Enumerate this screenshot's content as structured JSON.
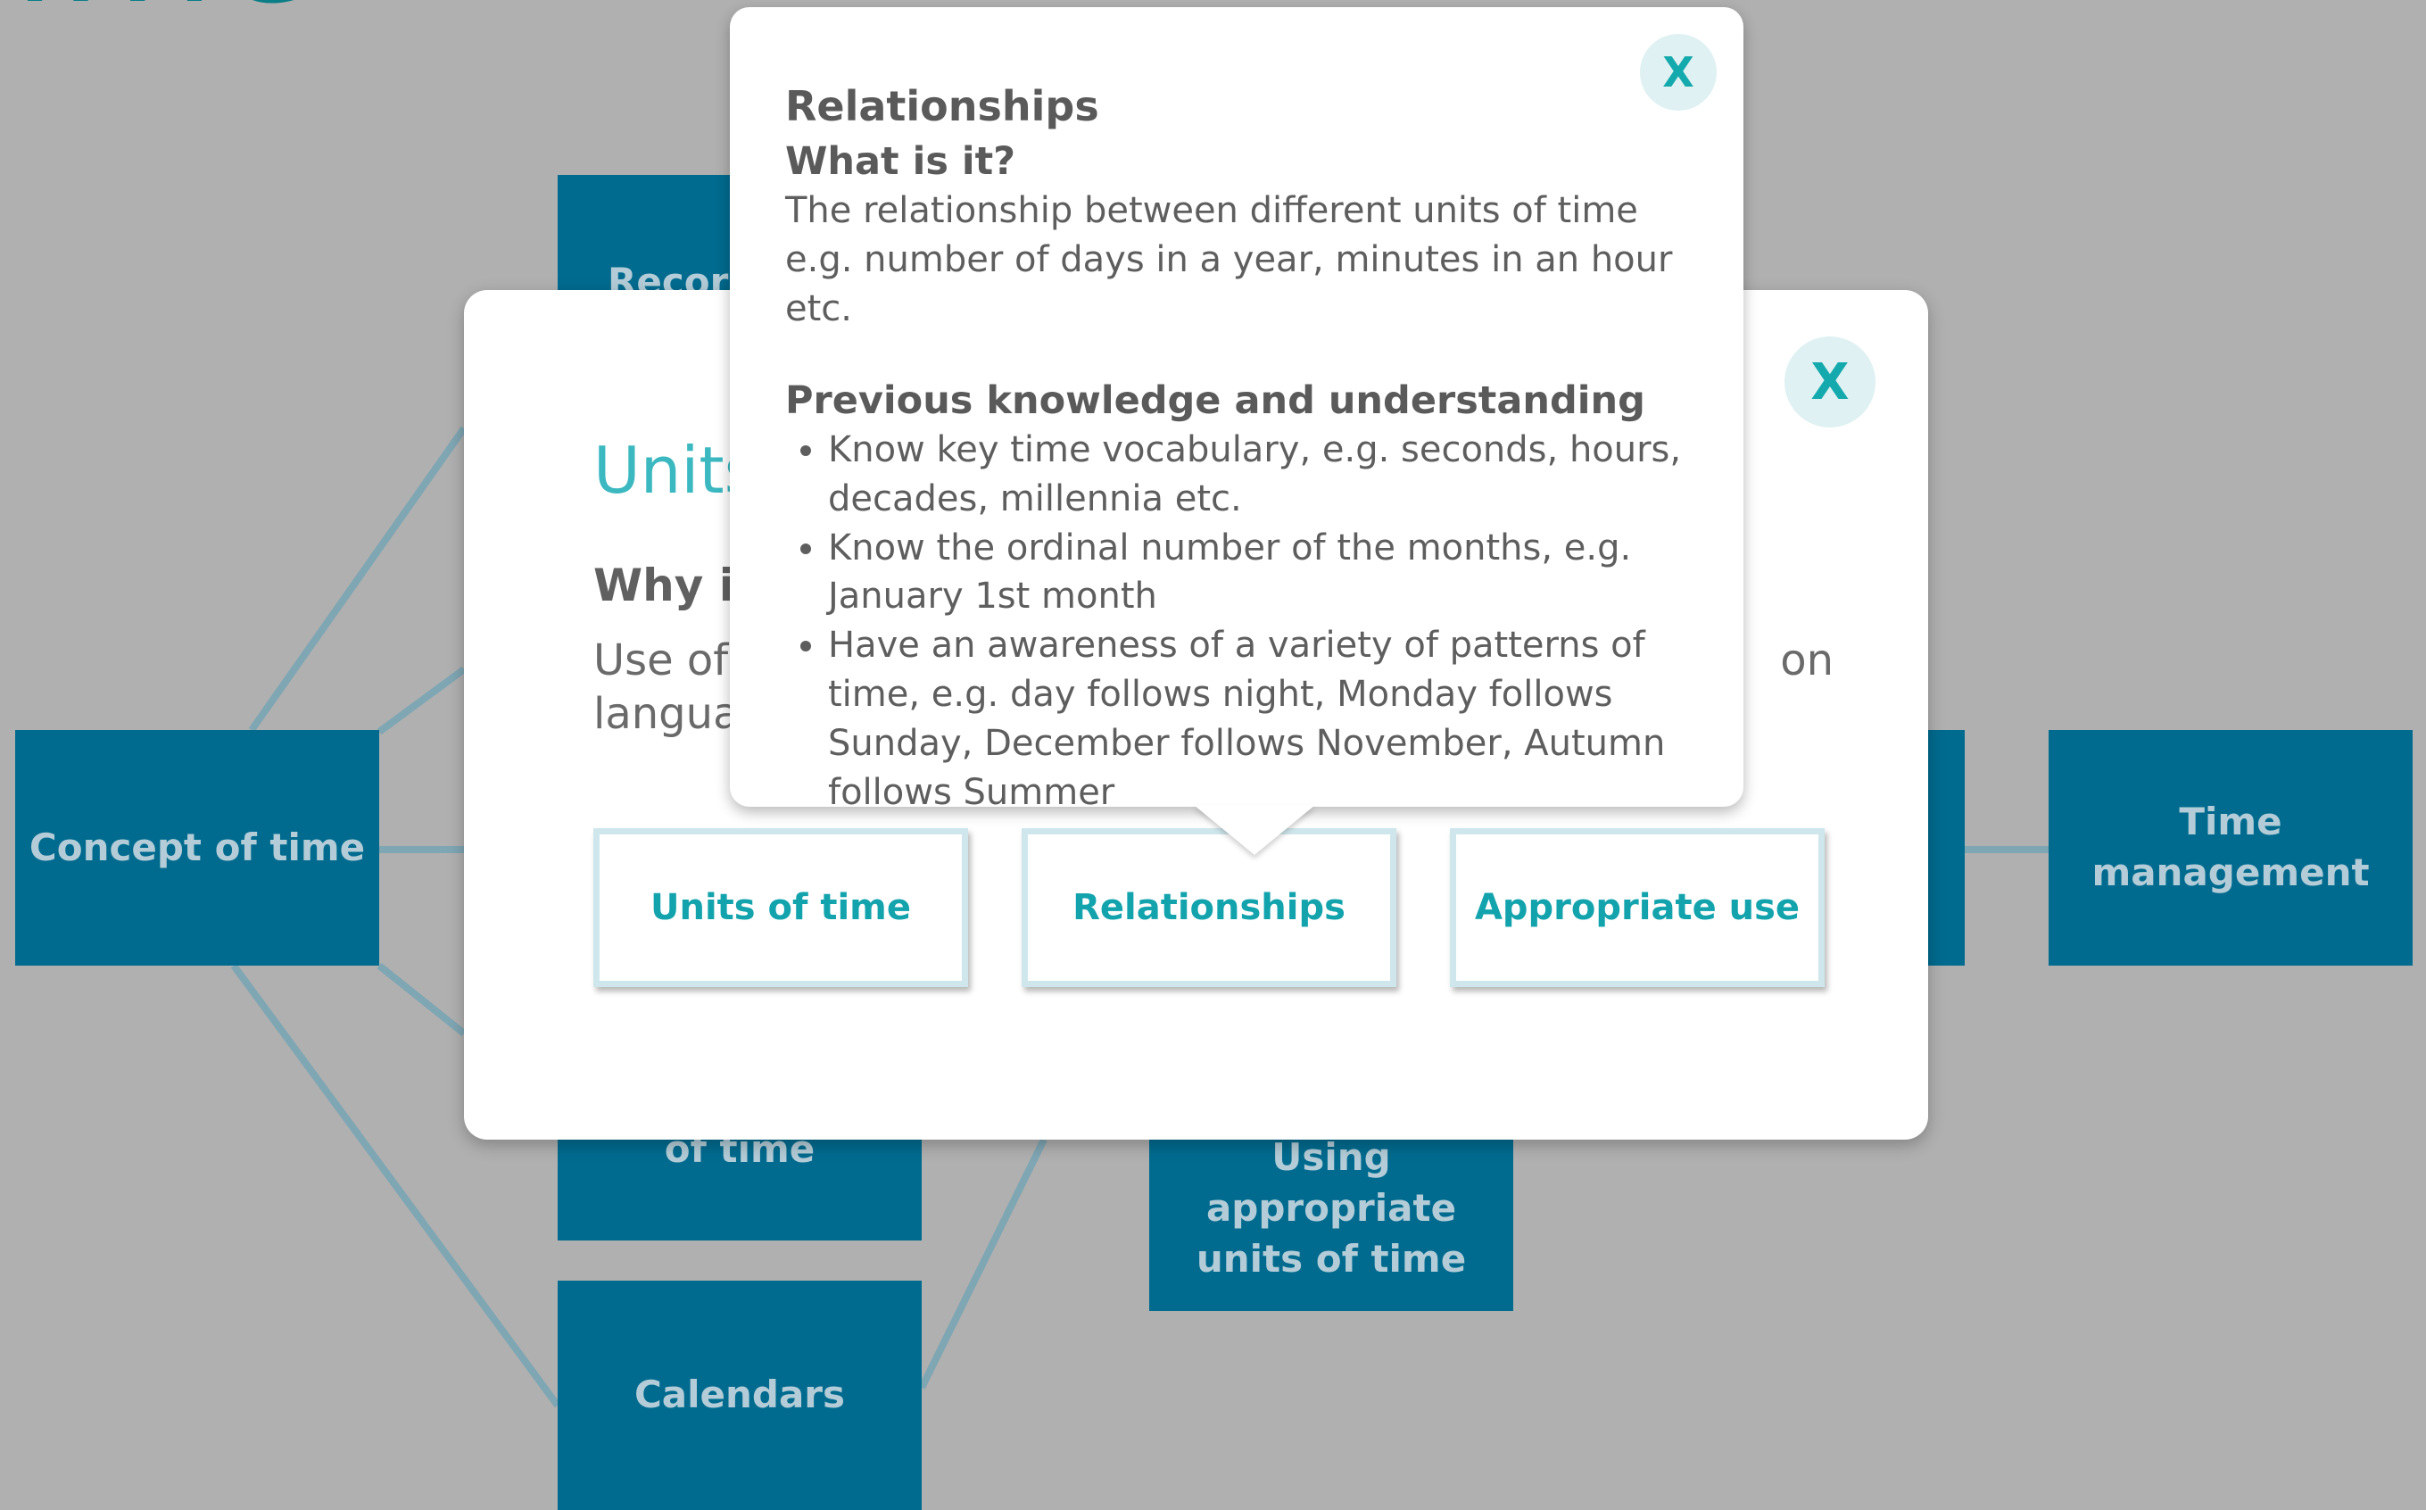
{
  "page": {
    "title_fragment": "ime"
  },
  "concept_map": {
    "concept": "Concept of time",
    "recording": "Record",
    "reading": "of time",
    "calendars": "Calendars",
    "using": "Using appropriate units of time",
    "time_management": "Time management"
  },
  "modal": {
    "close_label": "X",
    "heading": "Units",
    "subheading": "Why is",
    "body_line1": "Use of",
    "body_line1_end": "on",
    "body_line2": "languag",
    "tabs": [
      {
        "label": "Units of time"
      },
      {
        "label": "Relationships"
      },
      {
        "label": "Appropriate use"
      }
    ]
  },
  "popover": {
    "close_label": "X",
    "title": "Relationships",
    "what_label": "What is it?",
    "what_text": "The relationship between different units of time e.g. number of days in a year, minutes in an hour etc.",
    "prev_label": "Previous knowledge and understanding",
    "prev_items": [
      "Know key time vocabulary, e.g. seconds, hours, decades, millennia etc.",
      "Know the ordinal number of the months, e.g. January 1st month",
      "Have an awareness of a variety of patterns of time, e.g. day follows night, Monday follows Sunday, December follows November, Autumn follows Summer"
    ]
  },
  "colors": {
    "background": "#b0b0b0",
    "box": "#006b8f",
    "box_text": "#b3ccd7",
    "accent": "#12a3ad",
    "connector": "#7fa6b3"
  }
}
